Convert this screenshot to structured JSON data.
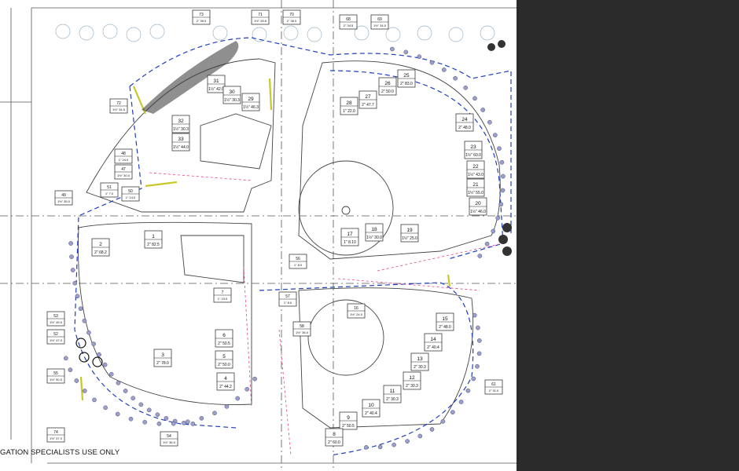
{
  "footer_note": "GATION SPECIALISTS USE ONLY",
  "colors": {
    "background": "#2b2b2b",
    "sheet": "#ffffff",
    "mainline": "#1f3fbf",
    "lateral_pink": "#e0458a",
    "drip_yellow": "#c9c82a",
    "tree": "#9fb7c8"
  },
  "top_ref_tags": [
    {
      "num": "73",
      "spec": "2\" 39.0"
    },
    {
      "num": "71",
      "spec": "1½\" 28.8"
    },
    {
      "num": "70",
      "spec": "2\" 36.0"
    },
    {
      "num": "68",
      "spec": "2\" 34.5"
    },
    {
      "num": "69",
      "spec": "1½\" 34.5"
    }
  ],
  "zone_tags": [
    {
      "num": "31",
      "spec": "1½\" 42.0"
    },
    {
      "num": "30",
      "spec": "1½\" 30.3"
    },
    {
      "num": "29",
      "spec": "1½\" 46.3"
    },
    {
      "num": "32",
      "spec": "1½\" 30.3"
    },
    {
      "num": "33",
      "spec": "1½\" 44.0"
    },
    {
      "num": "72",
      "spec": "1½\" 34.5"
    },
    {
      "num": "28",
      "spec": "1\" 22.0"
    },
    {
      "num": "27",
      "spec": "2\" 47.7"
    },
    {
      "num": "26",
      "spec": "2\" 50.0"
    },
    {
      "num": "25",
      "spec": "2\" 83.0"
    },
    {
      "num": "24",
      "spec": "2\" 48.0"
    },
    {
      "num": "23",
      "spec": "1½\" 60.0"
    },
    {
      "num": "22",
      "spec": "1½\" 43.0"
    },
    {
      "num": "21",
      "spec": "1½\" 55.0"
    },
    {
      "num": "20",
      "spec": "1½\" 46.0"
    },
    {
      "num": "48",
      "spec": "1\" 24.0"
    },
    {
      "num": "47",
      "spec": "1½\" 30.0"
    },
    {
      "num": "51",
      "spec": "1\" 7.0"
    },
    {
      "num": "50",
      "spec": "1\" 14.0"
    },
    {
      "num": "49",
      "spec": "1½\" 35.0"
    },
    {
      "num": "2",
      "spec": "2\" 68.2"
    },
    {
      "num": "1",
      "spec": "2\" 82.5"
    },
    {
      "num": "17",
      "spec": "1\" 8.10"
    },
    {
      "num": "18",
      "spec": "1½\" 30.0"
    },
    {
      "num": "19",
      "spec": "1½\" 25.0"
    },
    {
      "num": "56",
      "spec": "1\" 8.0"
    },
    {
      "num": "7",
      "spec": "1\" 19.0"
    },
    {
      "num": "57",
      "spec": "1\" 8.0"
    },
    {
      "num": "16",
      "spec": "1½\" 24.0"
    },
    {
      "num": "53",
      "spec": "1½\" 45.0"
    },
    {
      "num": "52",
      "spec": "1½\" 47.0"
    },
    {
      "num": "6",
      "spec": "2\" 50.5"
    },
    {
      "num": "5",
      "spec": "2\" 50.0"
    },
    {
      "num": "4",
      "spec": "2\" 44.2"
    },
    {
      "num": "3",
      "spec": "2\" 78.0"
    },
    {
      "num": "55",
      "spec": "1½\" 50.0"
    },
    {
      "num": "58",
      "spec": "1½\" 36.0"
    },
    {
      "num": "15",
      "spec": "2\" 48.0"
    },
    {
      "num": "14",
      "spec": "2\" 40.4"
    },
    {
      "num": "13",
      "spec": "2\" 30.3"
    },
    {
      "num": "12",
      "spec": "2\" 30.3"
    },
    {
      "num": "11",
      "spec": "2\" 30.3"
    },
    {
      "num": "10",
      "spec": "2\" 40.4"
    },
    {
      "num": "9",
      "spec": "2\" 50.5"
    },
    {
      "num": "8",
      "spec": "2\" 60.0"
    },
    {
      "num": "74",
      "spec": "1½\" 37.0"
    },
    {
      "num": "54",
      "spec": "1½\" 36.0"
    },
    {
      "num": "61",
      "spec": "2\" 31.0"
    }
  ]
}
